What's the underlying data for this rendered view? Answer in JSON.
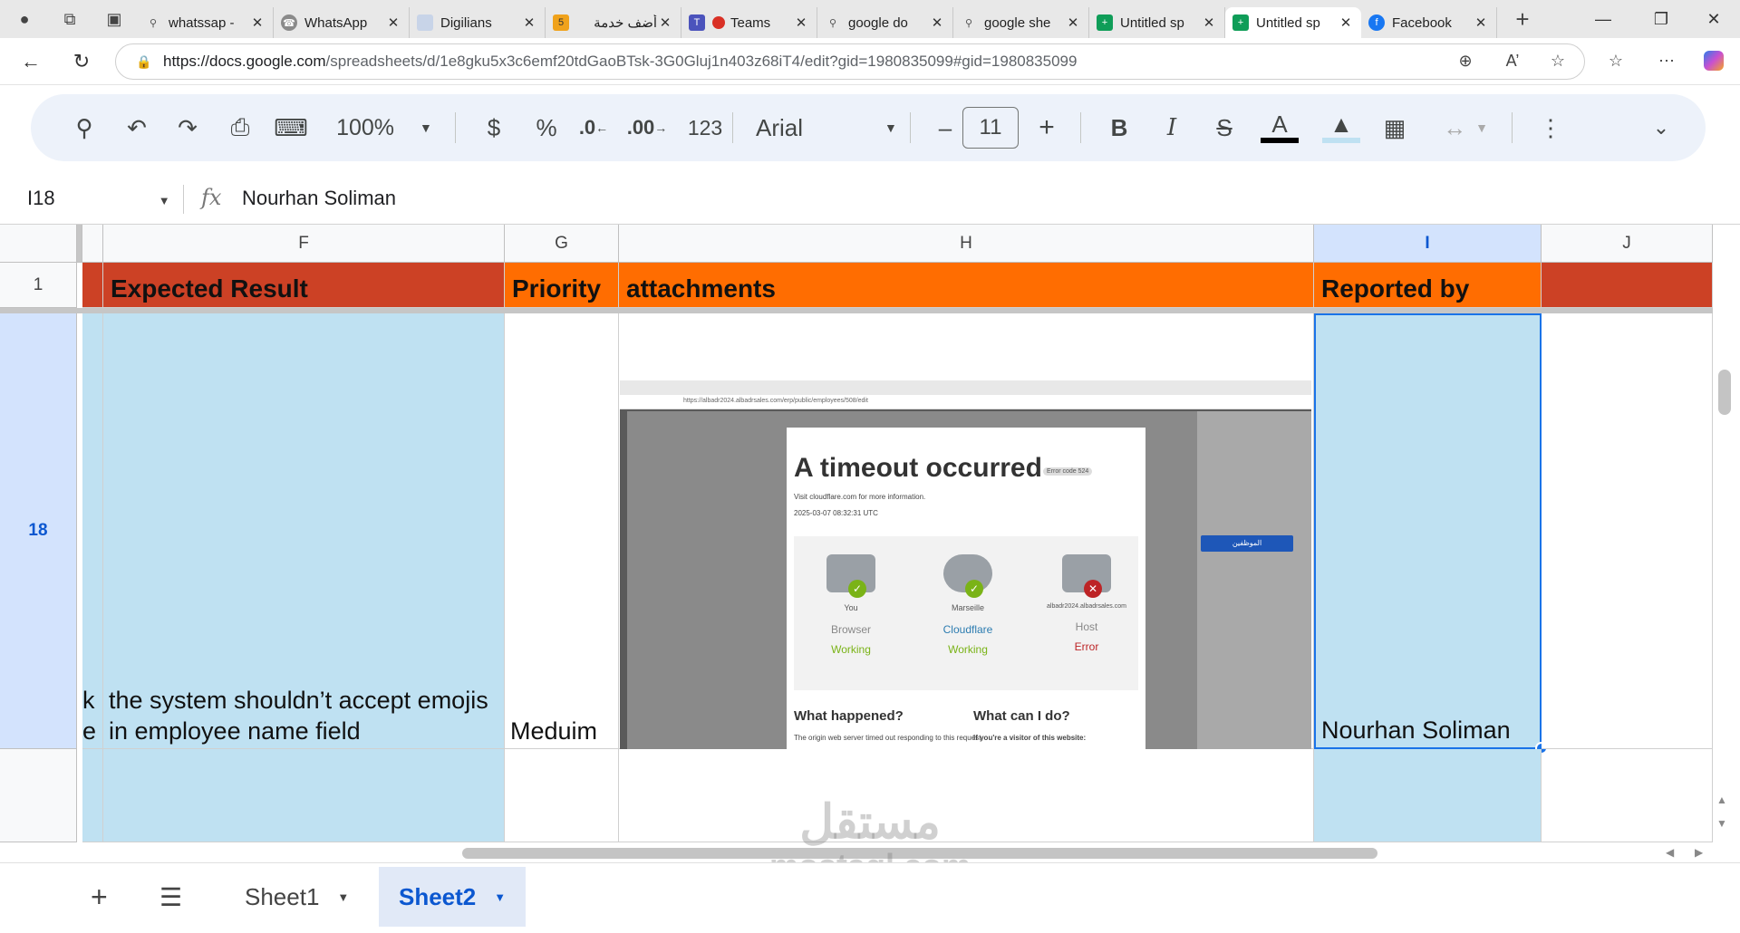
{
  "browser": {
    "tabs": [
      {
        "title": "whatssap -",
        "icon": "search-icon",
        "active": false
      },
      {
        "title": "WhatsApp",
        "icon": "whatsapp-icon",
        "active": false
      },
      {
        "title": "Digilians",
        "icon": "digilians-icon",
        "active": false
      },
      {
        "title": "أضف خدمة",
        "icon": "mostaql-icon",
        "active": false
      },
      {
        "title": "Teams",
        "icon": "teams-icon",
        "active": false
      },
      {
        "title": "google do",
        "icon": "search-icon",
        "active": false
      },
      {
        "title": "google she",
        "icon": "search-icon",
        "active": false
      },
      {
        "title": "Untitled sp",
        "icon": "sheets-icon",
        "active": false
      },
      {
        "title": "Untitled sp",
        "icon": "sheets-icon",
        "active": true
      },
      {
        "title": "Facebook",
        "icon": "facebook-icon",
        "active": false
      }
    ],
    "url_host": "https://docs.google.com",
    "url_path": "/spreadsheets/d/1e8gku5x3c6emf20tdGaoBTsk-3G0Gluj1n403z68iT4/edit?gid=1980835099#gid=1980835099"
  },
  "toolbar": {
    "zoom": "100%",
    "currency": "$",
    "percent": "%",
    "dec_decrease": ".0",
    "dec_increase": ".00",
    "number_format": "123",
    "font": "Arial",
    "font_size": "11",
    "minus": "–",
    "plus": "+",
    "bold": "B",
    "italic": "I",
    "strike": "S",
    "text_color": "A"
  },
  "formula_bar": {
    "cell_ref": "I18",
    "fx": "fx",
    "content": "Nourhan Soliman"
  },
  "columns": [
    {
      "letter": ""
    },
    {
      "letter": "F"
    },
    {
      "letter": "G"
    },
    {
      "letter": "H"
    },
    {
      "letter": "I"
    },
    {
      "letter": "J"
    }
  ],
  "rows": {
    "row1": "1",
    "row18": "18"
  },
  "header_row": {
    "expected_result": "Expected Result",
    "priority": "Priority",
    "attachments": "attachments",
    "reported_by": "Reported by"
  },
  "row18": {
    "partial_left": "k\ne",
    "expected_result": "the system shouldn’t accept emojis in employee name field",
    "priority": "Meduim",
    "reported_by": "Nourhan Soliman"
  },
  "attachment_image": {
    "title": "A timeout occurred",
    "error_code": "Error code 524",
    "visit_text": "Visit cloudflare.com for more information.",
    "timestamp": "2025-03-07 08:32:31 UTC",
    "nodes": [
      {
        "who": "You",
        "name": "Browser",
        "status": "Working",
        "status_color": "#7ab317"
      },
      {
        "who": "Marseille",
        "name": "Cloudflare",
        "status": "Working",
        "status_color": "#7ab317"
      },
      {
        "who": "albadr2024.albadrsales.com",
        "name": "Host",
        "status": "Error",
        "status_color": "#bd2426"
      }
    ],
    "what_happened": "What happened?",
    "what_can_i_do": "What can I do?",
    "happened_text": "The origin web server timed out responding to this request.",
    "visitor_text": "If you're a visitor of this website:",
    "mini_url": "https://albadr2024.albadrsales.com/erp/public/employees/508/edit",
    "sidebar_active": "الموظفين"
  },
  "sheets": {
    "sheet1": "Sheet1",
    "sheet2": "Sheet2",
    "active": "Sheet2"
  },
  "watermark": {
    "arabic": "مستقل",
    "latin": "mostaql.com"
  },
  "colors": {
    "header_red": "#cc4125",
    "header_orange": "#ff6d01",
    "selection_fill": "#bfe1f2",
    "selection_border": "#1a73e8",
    "active_tab": "#0b57d0"
  }
}
